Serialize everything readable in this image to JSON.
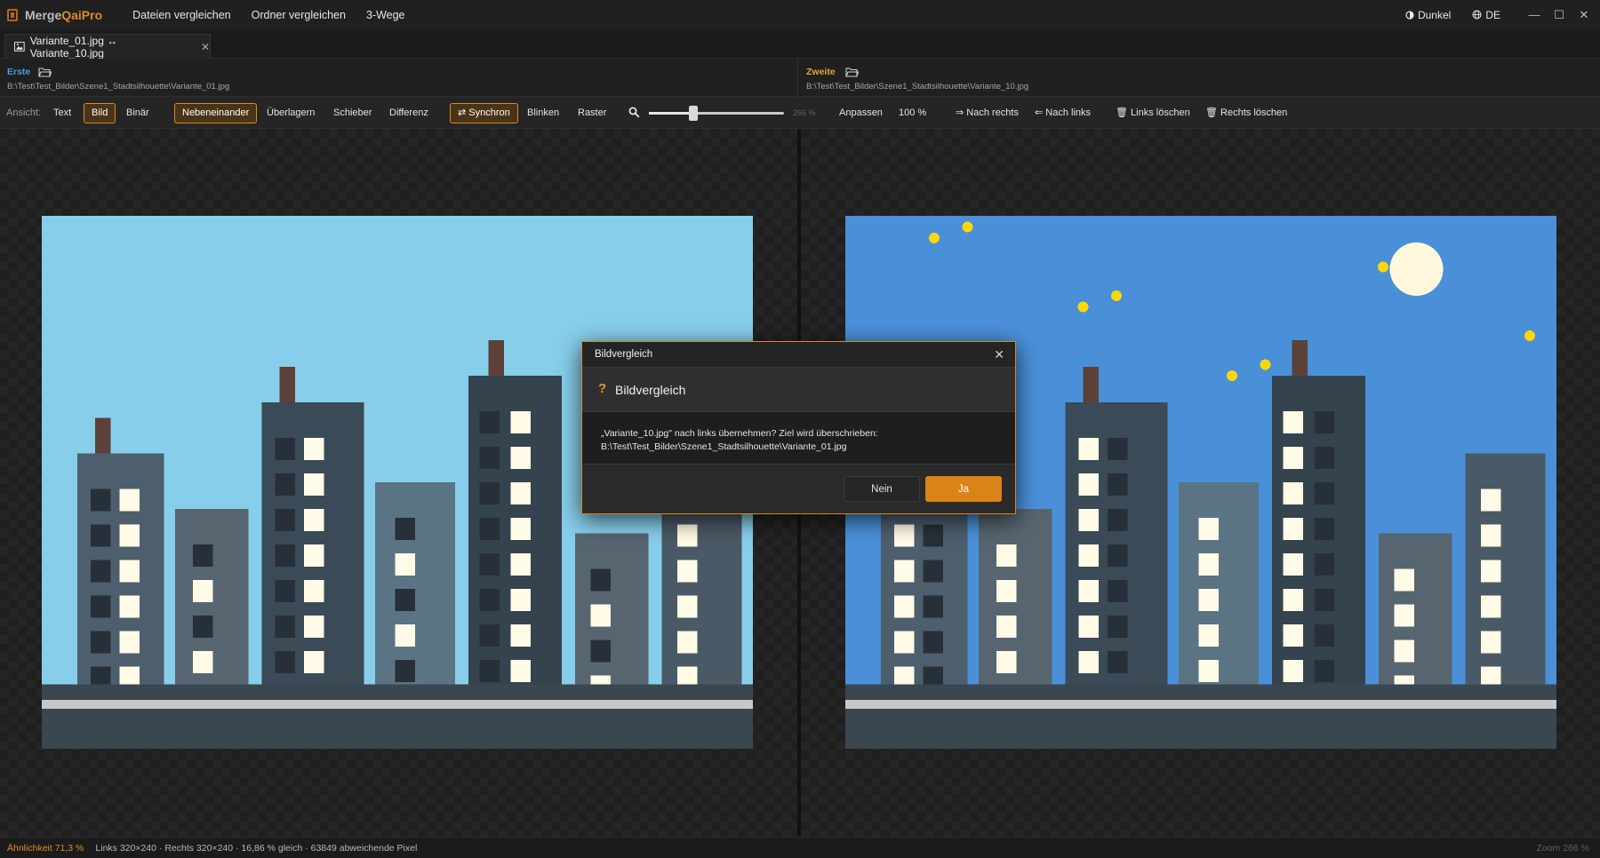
{
  "app": {
    "name_part1": "Merge",
    "name_part2": "QaiPro",
    "menu": [
      "Dateien vergleichen",
      "Ordner vergleichen",
      "3-Wege"
    ],
    "theme_label": "Dunkel",
    "language_label": "DE"
  },
  "tab": {
    "label": "Variante_01.jpg ↔ Variante_10.jpg"
  },
  "left": {
    "title": "Erste",
    "path": "B:\\Test\\Test_Bilder\\Szene1_Stadtsilhouette\\Variante_01.jpg"
  },
  "right": {
    "title": "Zweite",
    "path": "B:\\Test\\Test_Bilder\\Szene1_Stadtsilhouette\\Variante_10.jpg"
  },
  "toolbar": {
    "view_label": "Ansicht:",
    "view_modes": [
      "Text",
      "Bild",
      "Binär"
    ],
    "active_view": "Bild",
    "compare_modes": [
      "Nebeneinander",
      "Überlagern",
      "Schieber",
      "Differenz"
    ],
    "active_compare": "Nebeneinander",
    "sync_label": "⇄ Synchron",
    "blink_label": "Blinken",
    "grid_label": "Raster",
    "zoom_fraction": 0.33,
    "zoom_value": "266 %",
    "fit_label": "Anpassen",
    "hundred_label": "100 %",
    "copy_right_label": "⇒ Nach rechts",
    "copy_left_label": "⇐ Nach links",
    "delete_left_label": "Links löschen",
    "delete_right_label": "Rechts löschen"
  },
  "colors": {
    "accent": "#d98416",
    "sky_left": "#87ceeb",
    "sky_right": "#4a90d9",
    "moon": "#fff8dc",
    "star": "#ffd700"
  },
  "dialog": {
    "window_title": "Bildvergleich",
    "heading": "Bildvergleich",
    "message": "„Variante_10.jpg\" nach links übernehmen? Ziel wird überschrieben: B:\\Test\\Test_Bilder\\Szene1_Stadtsilhouette\\Variante_01.jpg",
    "no_label": "Nein",
    "yes_label": "Ja"
  },
  "status": {
    "similarity": "Ähnlichkeit 71,3 %",
    "info": "Links 320×240 · Rechts 320×240  ·  16,86 % gleich · 63849 abweichende Pixel",
    "zoom": "Zoom 266 %"
  }
}
